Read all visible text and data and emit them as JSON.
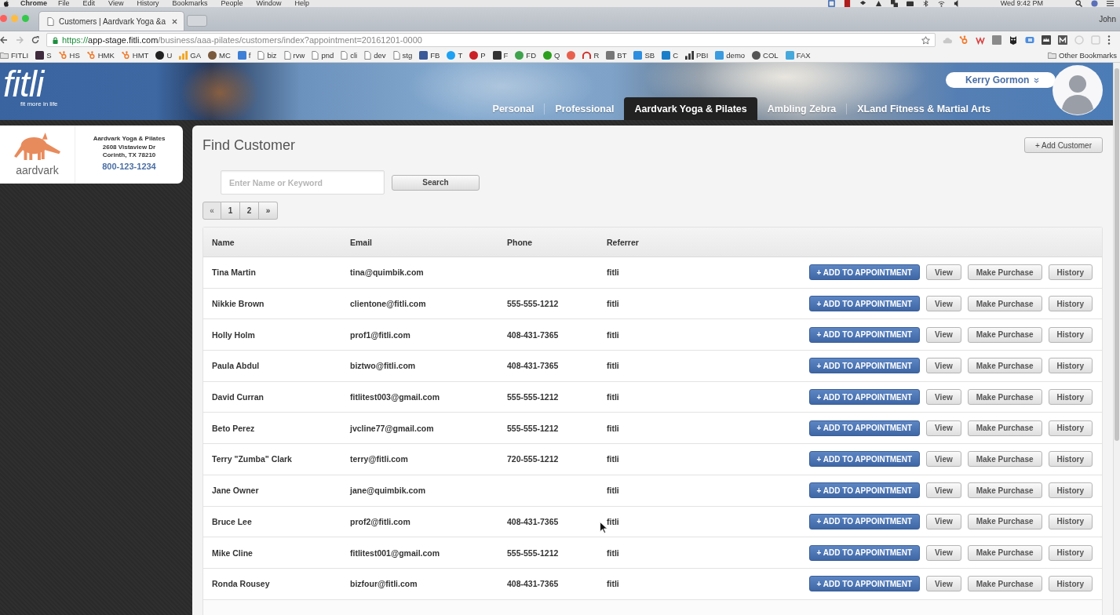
{
  "menu_bar": {
    "app": "Chrome",
    "items": [
      "File",
      "Edit",
      "View",
      "History",
      "Bookmarks",
      "People",
      "Window",
      "Help"
    ],
    "clock": "Wed 9:42 PM"
  },
  "browser": {
    "tabs": [
      {
        "title": "Customers | Aardvark Yoga &a",
        "selected": true
      }
    ],
    "profile": "John",
    "address": {
      "scheme": "https://",
      "host": "app-stage.fitli.com",
      "path": "/business/aaa-pilates/customers/index?appointment=20161201-0000"
    },
    "bookmarks": [
      {
        "label": "FITLI",
        "kind": "folder"
      },
      {
        "label": "S",
        "kind": "tile",
        "color": "#3e2a3c"
      },
      {
        "label": "HS",
        "kind": "sprocket",
        "color": "#f07b2e"
      },
      {
        "label": "HMK",
        "kind": "sprocket",
        "color": "#f07b2e"
      },
      {
        "label": "HMT",
        "kind": "sprocket",
        "color": "#f07b2e"
      },
      {
        "label": "U",
        "kind": "dot",
        "color": "#222222"
      },
      {
        "label": "GA",
        "kind": "bars",
        "color": "#f2a41c"
      },
      {
        "label": "MC",
        "kind": "dot",
        "color": "#7a5a3c"
      },
      {
        "label": "f",
        "kind": "tile",
        "color": "#3d7fd6"
      },
      {
        "label": "biz",
        "kind": "page"
      },
      {
        "label": "rvw",
        "kind": "page"
      },
      {
        "label": "pnd",
        "kind": "page"
      },
      {
        "label": "cli",
        "kind": "page"
      },
      {
        "label": "dev",
        "kind": "page"
      },
      {
        "label": "stg",
        "kind": "page"
      },
      {
        "label": "FB",
        "kind": "tile",
        "color": "#3b5998"
      },
      {
        "label": "T",
        "kind": "dot",
        "color": "#1da1f2"
      },
      {
        "label": "P",
        "kind": "dot",
        "color": "#cb2027"
      },
      {
        "label": "F",
        "kind": "tile",
        "color": "#333333"
      },
      {
        "label": "FD",
        "kind": "dot",
        "color": "#3fa34d"
      },
      {
        "label": "Q",
        "kind": "dot",
        "color": "#2ca01c"
      },
      {
        "kind": "dot",
        "color": "#e8604c"
      },
      {
        "label": "R",
        "kind": "arc",
        "color": "#d0312d"
      },
      {
        "label": "BT",
        "kind": "tile",
        "color": "#777777"
      },
      {
        "label": "SB",
        "kind": "tile",
        "color": "#2d8ee0"
      },
      {
        "label": "C",
        "kind": "tile",
        "color": "#1a7fc8"
      },
      {
        "label": "PBI",
        "kind": "bars",
        "color": "#333333"
      },
      {
        "label": "demo",
        "kind": "tile",
        "color": "#3a9be0"
      },
      {
        "label": "COL",
        "kind": "dot",
        "color": "#555555"
      },
      {
        "label": "FAX",
        "kind": "tile",
        "color": "#46a9dc"
      }
    ],
    "other_bookmarks": "Other Bookmarks"
  },
  "header": {
    "logo": "fitli",
    "tagline": "fit more in life",
    "user": {
      "name": "Kerry Gormon"
    },
    "tabs": [
      {
        "label": "Personal",
        "selected": false
      },
      {
        "label": "Professional",
        "selected": false
      },
      {
        "label": "Aardvark Yoga & Pilates",
        "selected": true
      },
      {
        "label": "Ambling Zebra",
        "selected": false
      },
      {
        "label": "XLand Fitness & Martial Arts",
        "selected": false
      }
    ]
  },
  "business": {
    "logo_text": "aardvark",
    "name": "Aardvark Yoga & Pilates",
    "street": "2608 Vistaview Dr",
    "city": "Corinth, TX 78210",
    "phone": "800-123-1234"
  },
  "find_customer": {
    "title": "Find Customer",
    "add_button": "+ Add Customer",
    "search": {
      "placeholder": "Enter Name or Keyword",
      "button": "Search"
    },
    "pagination": [
      {
        "label": "«",
        "disabled": true
      },
      {
        "label": "1",
        "disabled": false
      },
      {
        "label": "2",
        "disabled": false
      },
      {
        "label": "»",
        "disabled": false
      }
    ]
  },
  "table": {
    "columns": [
      "Name",
      "Email",
      "Phone",
      "Referrer"
    ],
    "rows": [
      {
        "name": "Tina Martin",
        "email": "tina@quimbik.com",
        "referrer": "fitli",
        "actions": [
          {
            "label": "+ ADD TO APPOINTMENT",
            "kind": "add"
          },
          {
            "label": "View",
            "kind": "view"
          },
          {
            "label": "Make Purchase",
            "kind": "purchase"
          },
          {
            "label": "History",
            "kind": "history"
          }
        ]
      },
      {
        "name": "Nikkie Brown",
        "email": "clientone@fitli.com",
        "phone": "555-555-1212",
        "referrer": "fitli",
        "actions": [
          {
            "label": "+ ADD TO APPOINTMENT",
            "kind": "add"
          },
          {
            "label": "View",
            "kind": "view"
          },
          {
            "label": "Make Purchase",
            "kind": "purchase"
          },
          {
            "label": "History",
            "kind": "history"
          }
        ]
      },
      {
        "name": "Holly Holm",
        "email": "prof1@fitli.com",
        "phone": "408-431-7365",
        "referrer": "fitli",
        "actions": [
          {
            "label": "+ ADD TO APPOINTMENT",
            "kind": "add"
          },
          {
            "label": "View",
            "kind": "view"
          },
          {
            "label": "Make Purchase",
            "kind": "purchase"
          },
          {
            "label": "History",
            "kind": "history"
          }
        ]
      },
      {
        "name": "Paula Abdul",
        "email": "biztwo@fitli.com",
        "phone": "408-431-7365",
        "referrer": "fitli",
        "actions": [
          {
            "label": "+ ADD TO APPOINTMENT",
            "kind": "add"
          },
          {
            "label": "View",
            "kind": "view"
          },
          {
            "label": "Make Purchase",
            "kind": "purchase"
          },
          {
            "label": "History",
            "kind": "history"
          }
        ]
      },
      {
        "name": "David Curran",
        "email": "fitlitest003@gmail.com",
        "phone": "555-555-1212",
        "referrer": "fitli",
        "actions": [
          {
            "label": "+ ADD TO APPOINTMENT",
            "kind": "add"
          },
          {
            "label": "View",
            "kind": "view"
          },
          {
            "label": "Make Purchase",
            "kind": "purchase"
          },
          {
            "label": "History",
            "kind": "history"
          }
        ]
      },
      {
        "name": "Beto Perez",
        "email": "jvcline77@gmail.com",
        "phone": "555-555-1212",
        "referrer": "fitli",
        "actions": [
          {
            "label": "+ ADD TO APPOINTMENT",
            "kind": "add"
          },
          {
            "label": "View",
            "kind": "view"
          },
          {
            "label": "Make Purchase",
            "kind": "purchase"
          },
          {
            "label": "History",
            "kind": "history"
          }
        ]
      },
      {
        "name": "Terry \"Zumba\" Clark",
        "email": "terry@fitli.com",
        "phone": "720-555-1212",
        "referrer": "fitli",
        "actions": [
          {
            "label": "+ ADD TO APPOINTMENT",
            "kind": "add"
          },
          {
            "label": "View",
            "kind": "view"
          },
          {
            "label": "Make Purchase",
            "kind": "purchase"
          },
          {
            "label": "History",
            "kind": "history"
          }
        ]
      },
      {
        "name": "Jane Owner",
        "email": "jane@quimbik.com",
        "referrer": "fitli",
        "actions": [
          {
            "label": "+ ADD TO APPOINTMENT",
            "kind": "add"
          },
          {
            "label": "View",
            "kind": "view"
          },
          {
            "label": "Make Purchase",
            "kind": "purchase"
          },
          {
            "label": "History",
            "kind": "history"
          }
        ]
      },
      {
        "name": "Bruce Lee",
        "email": "prof2@fitli.com",
        "phone": "408-431-7365",
        "referrer": "fitli",
        "actions": [
          {
            "label": "+ ADD TO APPOINTMENT",
            "kind": "add"
          },
          {
            "label": "View",
            "kind": "view"
          },
          {
            "label": "Make Purchase",
            "kind": "purchase"
          },
          {
            "label": "History",
            "kind": "history"
          }
        ]
      },
      {
        "name": "Mike Cline",
        "email": "fitlitest001@gmail.com",
        "phone": "555-555-1212",
        "referrer": "fitli",
        "actions": [
          {
            "label": "+ ADD TO APPOINTMENT",
            "kind": "add"
          },
          {
            "label": "View",
            "kind": "view"
          },
          {
            "label": "Make Purchase",
            "kind": "purchase"
          },
          {
            "label": "History",
            "kind": "history"
          }
        ]
      },
      {
        "name": "Ronda Rousey",
        "email": "bizfour@fitli.com",
        "phone": "408-431-7365",
        "referrer": "fitli",
        "actions": [
          {
            "label": "+ ADD TO APPOINTMENT",
            "kind": "add"
          },
          {
            "label": "View",
            "kind": "view"
          },
          {
            "label": "Make Purchase",
            "kind": "purchase"
          },
          {
            "label": "History",
            "kind": "history"
          }
        ]
      }
    ]
  }
}
